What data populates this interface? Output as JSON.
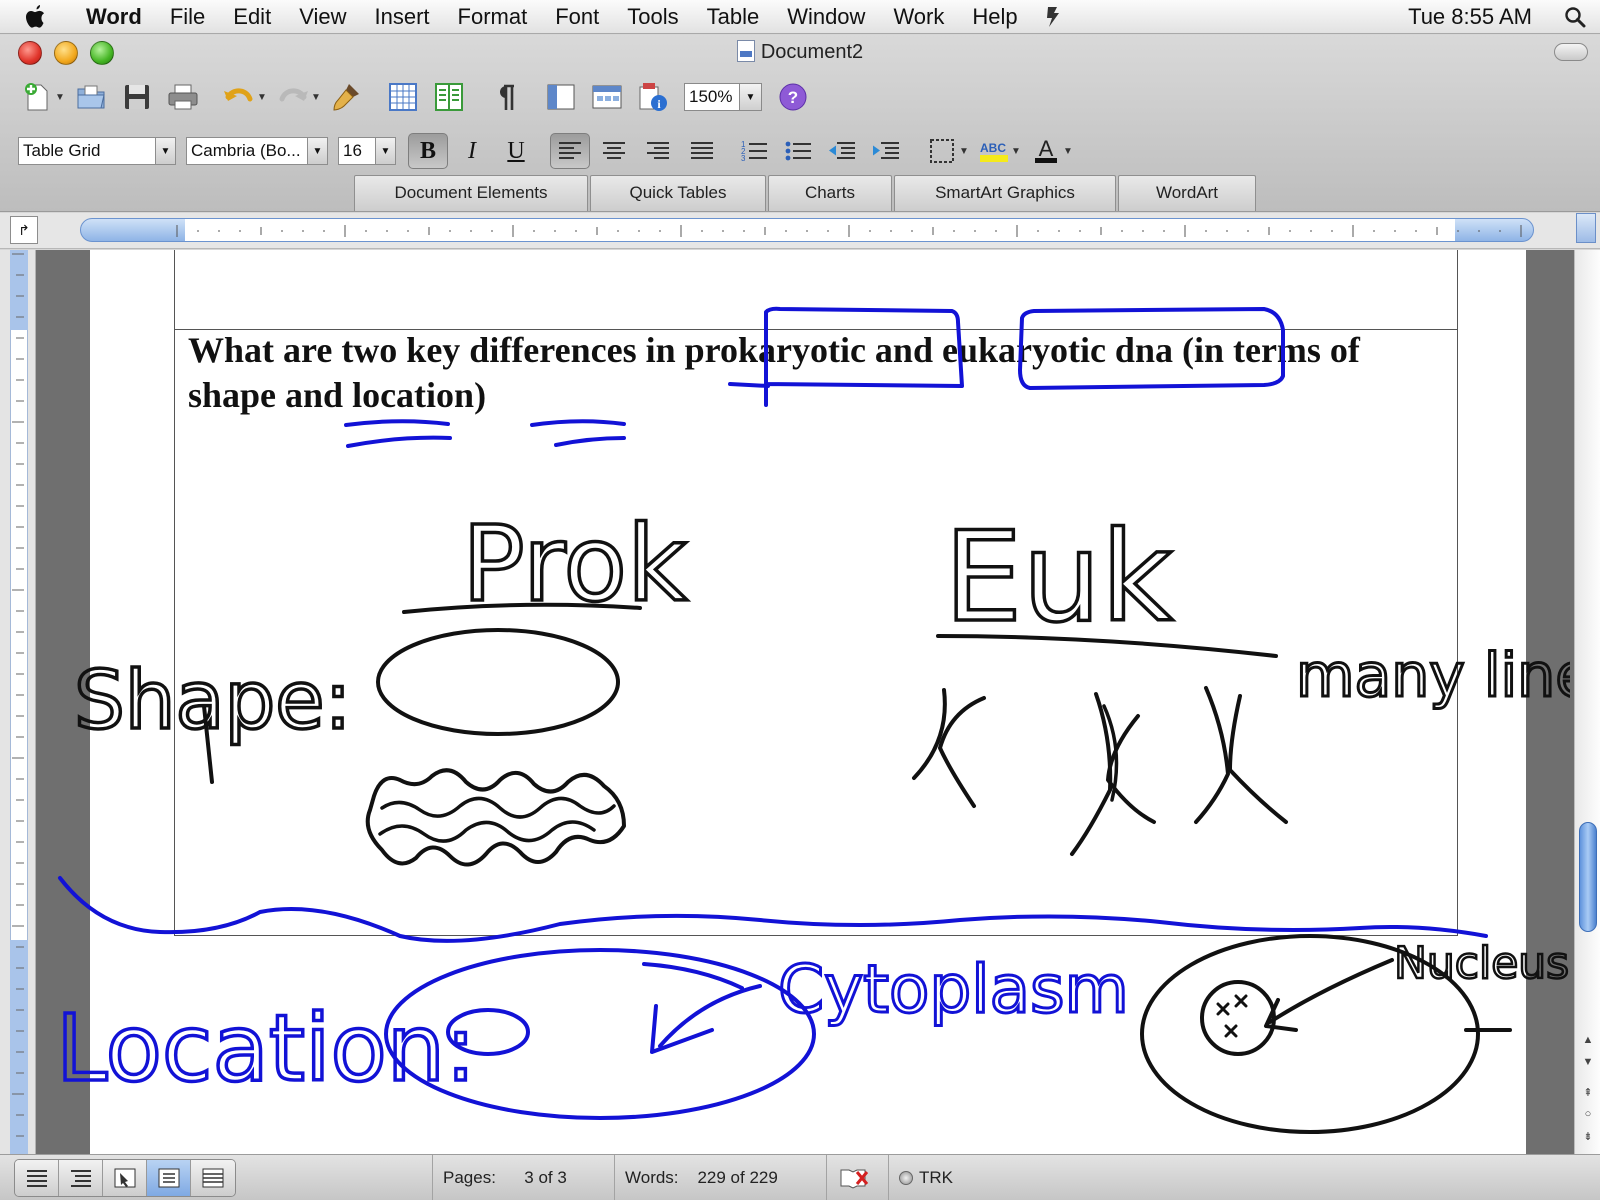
{
  "menubar": {
    "apple_icon": "apple-icon",
    "app_name": "Word",
    "items": [
      "File",
      "Edit",
      "View",
      "Insert",
      "Format",
      "Font",
      "Tools",
      "Table",
      "Window",
      "Work",
      "Help"
    ],
    "clock": "Tue 8:55 AM",
    "search_icon": "spotlight-icon"
  },
  "window": {
    "title": "Document2"
  },
  "toolbar": {
    "zoom": "150%",
    "help_glyph": "?"
  },
  "format_bar": {
    "style": "Table Grid",
    "font": "Cambria (Bo...",
    "size": "16",
    "bold": "B",
    "italic": "I",
    "underline": "U"
  },
  "gallery_tabs": [
    "Document Elements",
    "Quick Tables",
    "Charts",
    "SmartArt Graphics",
    "WordArt"
  ],
  "document": {
    "question": "What are two key differences in prokaryotic and eukaryotic dna (in terms of shape and location)"
  },
  "ink_labels": {
    "prok": "Prok",
    "euk": "Euk",
    "shape": "Shape:",
    "location": "Location:",
    "many_linear_strands": "many linear strands",
    "cytoplasm": "Cytoplasm",
    "nucleus": "Nucleus"
  },
  "status": {
    "pages_label": "Pages:",
    "pages_value": "3 of 3",
    "words_label": "Words:",
    "words_value": "229 of 229",
    "trk": "TRK"
  },
  "colors": {
    "ink_black": "#111111",
    "ink_blue": "#1212d6",
    "ruler_blue": "#8fb4e6"
  }
}
